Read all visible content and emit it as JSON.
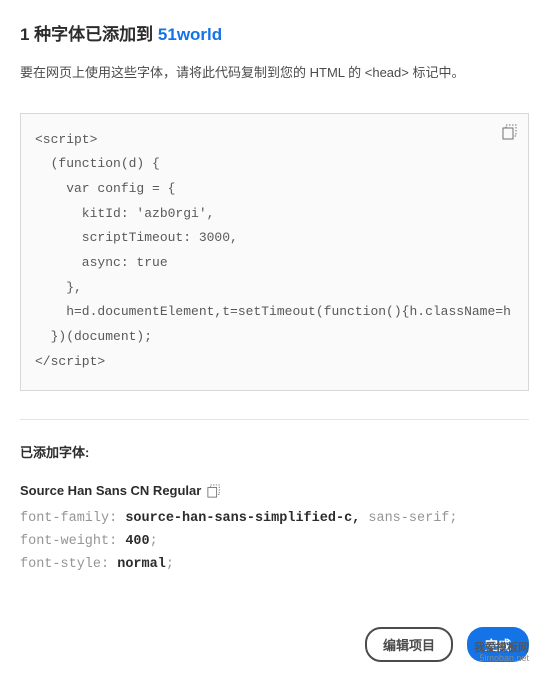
{
  "heading": {
    "prefix": "1 种字体已添加到 ",
    "project": "51world"
  },
  "instruction": "要在网页上使用这些字体，请将此代码复制到您的 HTML 的 <head> 标记中。",
  "script_code": "<script>\n  (function(d) {\n    var config = {\n      kitId: 'azb0rgi',\n      scriptTimeout: 3000,\n      async: true\n    },\n    h=d.documentElement,t=setTimeout(function(){h.className=h.className.replace(/\\bwf-loading\\b/g,\"\")+\" wf-inactive\";},config.scriptTimeout)\n  })(document);\n</script>",
  "added_label": "已添加字体:",
  "added_font": {
    "name": "Source Han Sans CN Regular",
    "family_prop": "font-family: ",
    "family_val": "source-han-sans-simplified-c,",
    "family_tail": " sans-serif;",
    "weight_prop": "font-weight: ",
    "weight_val": "400",
    "style_prop": "font-style: ",
    "style_val": "normal"
  },
  "buttons": {
    "edit": "编辑项目",
    "done": "完成"
  },
  "watermark": {
    "top": "我爱模板网",
    "bottom": "5imoban.net"
  }
}
